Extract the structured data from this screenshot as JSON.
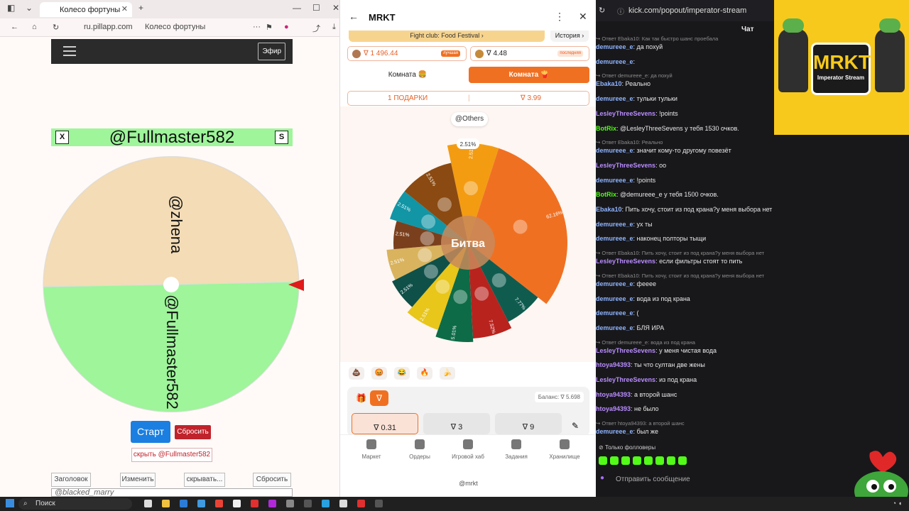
{
  "left_browser": {
    "tab_title": "Колесо фортуны",
    "url": "ru.pillapp.com",
    "page_title": "Колесо фортуны",
    "efir_label": "Эфир",
    "current_name": "@Fullmaster582",
    "x_label": "X",
    "s_label": "S",
    "wheel_labels": [
      "@zhena",
      "@Fullmaster582"
    ],
    "start_label": "Старт",
    "reset_red_label": "Сбросить",
    "hide_label": "скрыть @Fullmaster582",
    "buttons": [
      "Заголовок",
      "Изменить",
      "скрывать...",
      "Сбросить"
    ],
    "textarea_value": "@blacked_marry"
  },
  "mrkt": {
    "title": "MRKT",
    "banner": "Fight club: Food Festival",
    "history_label": "История",
    "stat_left_value": "∇ 1 496.44",
    "stat_left_tag": "лучшая",
    "stat_right_value": "∇ 4.48",
    "stat_right_tag": "последняя",
    "room_left": "Комната 🍔",
    "room_right": "Комната 🍟",
    "gifts_label": "1 ПОДАРКИ",
    "gifts_value": "∇ 3.99",
    "others_label": "@Others",
    "center_label": "Битва",
    "pointer_pct": "2.51%",
    "segments": [
      {
        "pct": "2.51%",
        "value": 2.51,
        "color": "#f39c12"
      },
      {
        "pct": "62.16%",
        "value": 62.16,
        "color": "#f07022"
      },
      {
        "pct": "7.77%",
        "value": 7.77,
        "color": "#0f5c4f"
      },
      {
        "pct": "7.52%",
        "value": 7.52,
        "color": "#b8231e"
      },
      {
        "pct": "5.01%",
        "value": 5.01,
        "color": "#0d6b47"
      },
      {
        "pct": "2.51%",
        "value": 2.51,
        "color": "#e8c61a"
      },
      {
        "pct": "2.51%",
        "value": 2.51,
        "color": "#0f5049"
      },
      {
        "pct": "2.51%",
        "value": 2.51,
        "color": "#d9b35e"
      },
      {
        "pct": "2.51%",
        "value": 2.51,
        "color": "#7a3f1c"
      },
      {
        "pct": "2.51%",
        "value": 2.51,
        "color": "#1295a5"
      },
      {
        "pct": "2.51%",
        "value": 2.51,
        "color": "#8a4a12"
      }
    ],
    "emojis": [
      "💩",
      "😡",
      "😂",
      "🔥",
      "🍌"
    ],
    "balance": "Баланс: ∇ 5.698",
    "bets": [
      "∇ 0.31",
      "∇ 3",
      "∇ 9"
    ],
    "nav": [
      "Маркет",
      "Ордеры",
      "Игровой хаб",
      "Задания",
      "Хранилище"
    ],
    "footer": "@mrkt"
  },
  "chat": {
    "url": "kick.com/popout/imperator-stream",
    "label": "Чат",
    "logo_title": "MRKT",
    "logo_sub": "Imperator Stream",
    "send_placeholder": "Отправить сообщение",
    "followers_label": "Только фолловеры",
    "lines": [
      {
        "reply": true,
        "text": "Ответ Ebaka10: Как так быстро шанс проебала"
      },
      {
        "user": "demureee_e",
        "color": "#8fb4ff",
        "text": ": да похуй"
      },
      {
        "user": "demureee_e",
        "color": "#8fb4ff",
        "text": ":"
      },
      {
        "reply": true,
        "text": "Ответ demureee_e: да похуй"
      },
      {
        "user": "Ebaka10",
        "color": "#8fb4ff",
        "text": ": Реально"
      },
      {
        "user": "demureee_e",
        "color": "#8fb4ff",
        "text": ": тульки тульки"
      },
      {
        "user": "LesleyThreeSevens",
        "color": "#b98cff",
        "text": ": !points"
      },
      {
        "user": "BotRix",
        "color": "#53fc18",
        "text": ": @LesleyThreeSevens у тебя 1530 очков."
      },
      {
        "reply": true,
        "text": "Ответ Ebaka10: Реально"
      },
      {
        "user": "demureee_e",
        "color": "#8fb4ff",
        "text": ": значит кому-то другому повезёт"
      },
      {
        "user": "LesleyThreeSevens",
        "color": "#b98cff",
        "text": ": оо"
      },
      {
        "user": "demureee_e",
        "color": "#8fb4ff",
        "text": ": !points"
      },
      {
        "user": "BotRix",
        "color": "#53fc18",
        "text": ": @demureee_e у тебя 1500 очков."
      },
      {
        "user": "Ebaka10",
        "color": "#8fb4ff",
        "text": ": Пить хочу, стоит из под крана?у меня выбора нет"
      },
      {
        "user": "demureee_e",
        "color": "#8fb4ff",
        "text": ": ух ты"
      },
      {
        "user": "demureee_e",
        "color": "#8fb4ff",
        "text": ": наконец полторы тыщи"
      },
      {
        "reply": true,
        "text": "Ответ Ebaka10: Пить хочу, стоит из под крана?у меня выбора нет"
      },
      {
        "user": "LesleyThreeSevens",
        "color": "#b98cff",
        "text": ": если фильтры стоят то пить"
      },
      {
        "reply": true,
        "text": "Ответ Ebaka10: Пить хочу, стоит из под крана?у меня выбора нет"
      },
      {
        "user": "demureee_e",
        "color": "#8fb4ff",
        "text": ": фееее"
      },
      {
        "user": "demureee_e",
        "color": "#8fb4ff",
        "text": ": вода из под крана"
      },
      {
        "user": "demureee_e",
        "color": "#8fb4ff",
        "text": ": ("
      },
      {
        "user": "demureee_e",
        "color": "#8fb4ff",
        "text": ": БЛЯ ИРА"
      },
      {
        "reply": true,
        "text": "Ответ demureee_e: вода из под крана"
      },
      {
        "user": "LesleyThreeSevens",
        "color": "#b98cff",
        "text": ": у меня чистая вода"
      },
      {
        "user": "htoya94393",
        "color": "#b98cff",
        "text": ": ты что султан две жены"
      },
      {
        "user": "LesleyThreeSevens",
        "color": "#b98cff",
        "text": ": из под крана"
      },
      {
        "user": "htoya94393",
        "color": "#b98cff",
        "text": ": а второй шанс"
      },
      {
        "user": "htoya94393",
        "color": "#b98cff",
        "text": ": не было"
      },
      {
        "reply": true,
        "text": "Ответ htoya94393: а второй шанс"
      },
      {
        "user": "demureee_e",
        "color": "#8fb4ff",
        "text": ": был же"
      }
    ]
  },
  "taskbar": {
    "search_label": "Поиск"
  }
}
